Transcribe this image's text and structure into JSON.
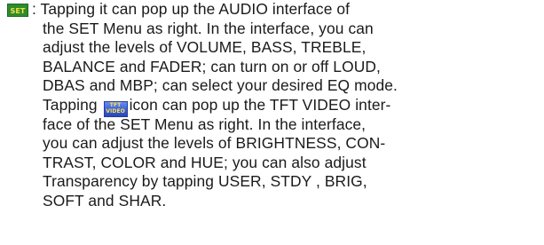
{
  "icons": {
    "set": {
      "name": "set-icon",
      "label": "SET",
      "color": "#2e8b2e"
    },
    "tft_video": {
      "name": "tft-video-icon",
      "label_top": "TFT",
      "label_bottom": "VIDEO",
      "color": "#3a5fd8"
    }
  },
  "lines": [
    ": Tapping it can pop up the AUDIO interface of",
    "the SET Menu as right. In the interface, you can",
    "adjust the levels of VOLUME, BASS, TREBLE,",
    "BALANCE and FADER; can turn on or off LOUD,",
    "DBAS and MBP;  can select your desired EQ mode.",
    "Tapping",
    "icon can pop up the TFT VIDEO inter-",
    "face of the SET Menu as right. In the interface,",
    "you can adjust the levels of BRIGHTNESS, CON-",
    "TRAST, COLOR and HUE; you can also adjust",
    "Transparency by tapping USER, STDY , BRIG,",
    "SOFT and SHAR."
  ]
}
